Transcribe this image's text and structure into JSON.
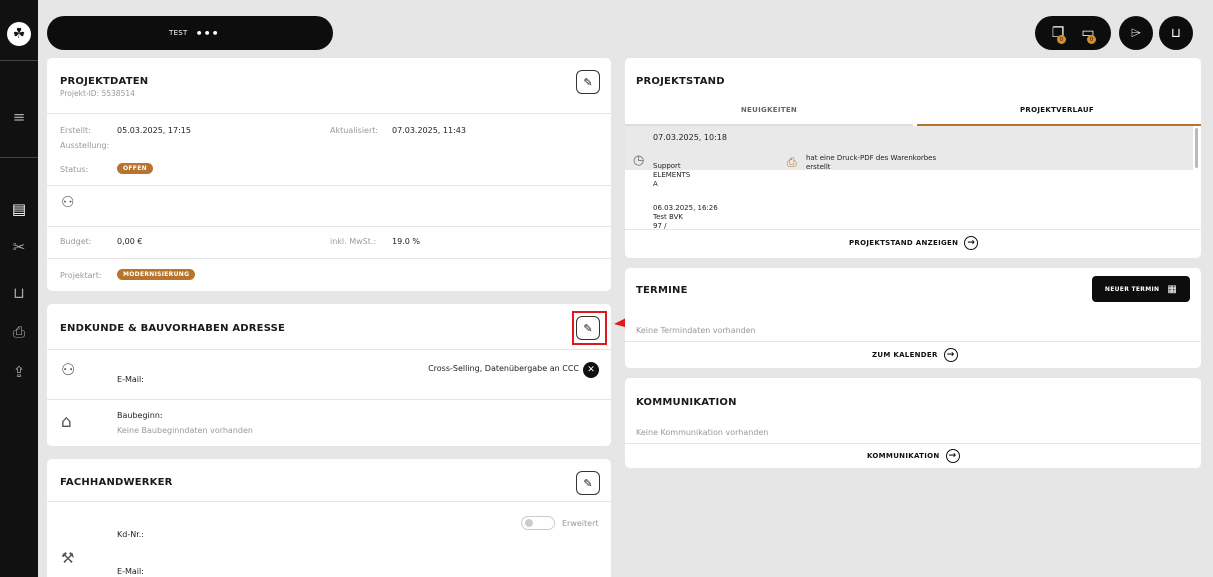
{
  "sidebar": {
    "logo_icon": "leaf-logo",
    "items": [
      {
        "name": "menu-icon",
        "glyph": "≡"
      },
      {
        "name": "clipboard-icon",
        "glyph": "▤"
      },
      {
        "name": "tools-icon",
        "glyph": "✕"
      },
      {
        "name": "cart-icon",
        "glyph": "⊔"
      },
      {
        "name": "printer-icon",
        "glyph": "⎙"
      },
      {
        "name": "share-icon",
        "glyph": "⇧"
      }
    ]
  },
  "topbar": {
    "title": "TEST",
    "more": "•••"
  },
  "top_actions": {
    "badge1": "0",
    "badge2": "0"
  },
  "projektdaten": {
    "title": "PROJEKTDATEN",
    "projekt_id": "Projekt-ID: 5538514",
    "erstellt_label": "Erstellt:",
    "erstellt_value": "05.03.2025, 17:15",
    "aktualisiert_label": "Aktualisiert:",
    "aktualisiert_value": "07.03.2025, 11:43",
    "ausstellung_label": "Ausstellung:",
    "status_label": "Status:",
    "status_value": "OFFEN",
    "budget_label": "Budget:",
    "budget_value": "0,00 €",
    "mwst_label": "inkl. MwSt.:",
    "mwst_value": "19.0 %",
    "projektart_label": "Projektart:",
    "projektart_value": "MODERNISIERUNG"
  },
  "endkunde": {
    "title": "ENDKUNDE & BAUVORHABEN ADRESSE",
    "email_label": "E-Mail:",
    "cross_selling": "Cross-Selling, Datenübergabe an CCC",
    "baubeginn_label": "Baubeginn:",
    "baubeginn_value": "Keine Baubeginndaten vorhanden"
  },
  "fachhandwerker": {
    "title": "FACHHANDWERKER",
    "toggle_label": "Erweitert",
    "kdnr_label": "Kd-Nr.:",
    "email_label": "E-Mail:"
  },
  "projektstand": {
    "title": "PROJEKTSTAND",
    "tabs": [
      "NEUIGKEITEN",
      "PROJEKTVERLAUF"
    ],
    "entries": [
      {
        "date": "07.03.2025, 10:18",
        "who1": "Support",
        "who2": "ELEMENTS",
        "who3": "A",
        "text1": "hat eine Druck-PDF des Warenkorbes",
        "text2": "erstellt"
      },
      {
        "date": "06.03.2025, 16:26",
        "who1": "Test BVK",
        "who2": "97 /"
      }
    ],
    "link": "PROJEKTSTAND ANZEIGEN"
  },
  "termine": {
    "title": "TERMINE",
    "new_button": "NEUER TERMIN",
    "empty": "Keine Termindaten vorhanden",
    "link": "ZUM KALENDER"
  },
  "kommunikation": {
    "title": "KOMMUNIKATION",
    "empty": "Keine Kommunikation vorhanden",
    "link": "KOMMUNIKATION"
  },
  "colors": {
    "accent": "#b8742c",
    "dark": "#0d0d0d",
    "highlight": "#e0191f"
  }
}
